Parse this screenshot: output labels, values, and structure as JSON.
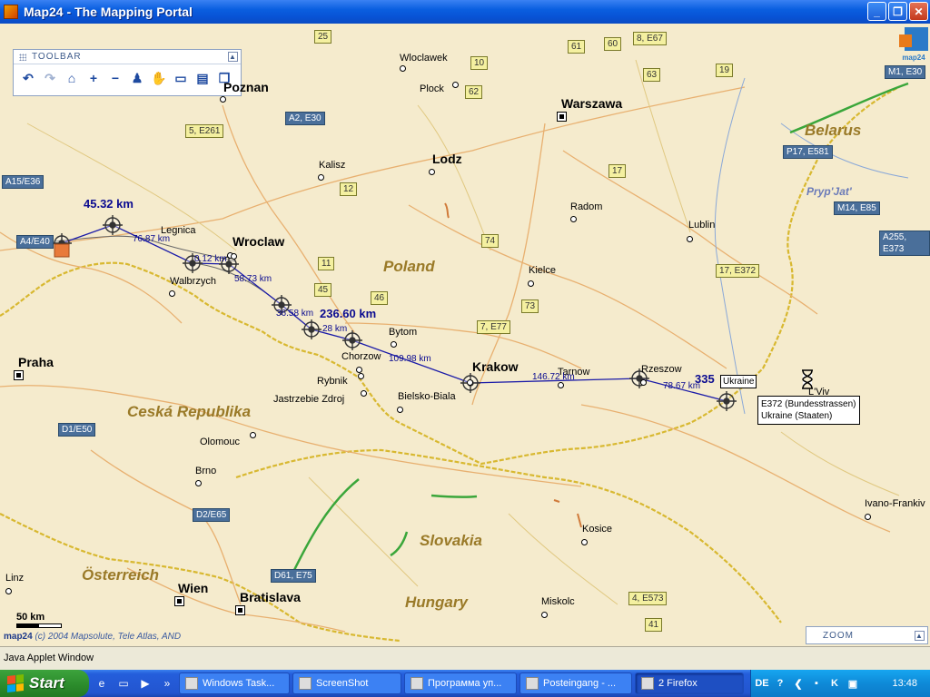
{
  "window": {
    "title": "Map24 - The Mapping Portal",
    "minimize": "_",
    "maximize": "❐",
    "close": "✕"
  },
  "toolbar": {
    "title": "TOOLBAR",
    "collapse": "▲",
    "tools": [
      {
        "icon": "back-arrow-icon",
        "glyph": "↶",
        "enabled": true
      },
      {
        "icon": "forward-arrow-icon",
        "glyph": "↷",
        "enabled": false
      },
      {
        "icon": "home-icon",
        "glyph": "⌂",
        "enabled": true
      },
      {
        "icon": "zoom-in-icon",
        "glyph": "+",
        "enabled": true
      },
      {
        "icon": "zoom-out-icon",
        "glyph": "−",
        "enabled": true
      },
      {
        "icon": "person-icon",
        "glyph": "♟",
        "enabled": true
      },
      {
        "icon": "hand-pan-icon",
        "glyph": "✋",
        "enabled": true
      },
      {
        "icon": "measure-icon",
        "glyph": "▭",
        "enabled": true
      },
      {
        "icon": "print-icon",
        "glyph": "▤",
        "enabled": true
      },
      {
        "icon": "windows-icon",
        "glyph": "❐",
        "enabled": true
      }
    ]
  },
  "map": {
    "countries": [
      "Poland",
      "Ceská Republika",
      "Slovakia",
      "Hungary",
      "Österreich",
      "Belarus"
    ],
    "river": "Pryp'Jat'",
    "cities_big": [
      "Warszawa",
      "Praha",
      "Wien",
      "Krakow",
      "Wroclaw",
      "Poznan",
      "Lodz",
      "Bratislava"
    ],
    "cities": [
      "Wloclawek",
      "Plock",
      "Kalisz",
      "Radom",
      "Lublin",
      "Kielce",
      "Legnica",
      "Walbrzych",
      "Bytom",
      "Chorzow",
      "Rybnik",
      "Jastrzebie Zdroj",
      "Bielsko-Biala",
      "Tarnow",
      "Rzeszow",
      "Olomouc",
      "Brno",
      "Kosice",
      "Miskolc",
      "Linz",
      "L'Viv",
      "Ivano-Frankiv"
    ],
    "shields_yellow": [
      "25",
      "10",
      "62",
      "61",
      "60",
      "8, E67",
      "63",
      "19",
      "5, E261",
      "12",
      "17",
      "74",
      "11",
      "45",
      "46",
      "73",
      "7, E77",
      "17, E372",
      "4, E573",
      "41"
    ],
    "shields_blue": [
      "A2, E30",
      "A15/E36",
      "A4/E40",
      "D1/E50",
      "D2/E65",
      "D61, E75",
      "M1, E30",
      "P17, E581",
      "M14, E85",
      "A255, E373"
    ],
    "route_total": [
      "45.32 km",
      "236.60 km",
      "335"
    ],
    "route_segments": [
      "76.87 km",
      "0.12 km",
      "58.73 km",
      "36.58 km",
      "28 km",
      "109.98 km",
      "146.72 km",
      "78.67 km"
    ],
    "tooltip": {
      "line1": "E372 (Bundesstrassen)",
      "line2": "Ukraine (Staaten)"
    },
    "ukraine_tag": "Ukraine",
    "scale_label": "50 km",
    "copyright_brand": "map24",
    "copyright_text": "(c) 2004 Mapsolute, Tele Atlas, AND",
    "logo_text": "map24"
  },
  "zoom": {
    "title": "ZOOM",
    "collapse": "▲"
  },
  "applet_status": "Java Applet Window",
  "taskbar": {
    "start": "Start",
    "more": "»",
    "tasks": [
      {
        "label": "Windows Task...",
        "active": false
      },
      {
        "label": "ScreenShot",
        "active": false
      },
      {
        "label": "Программа уп...",
        "active": false
      },
      {
        "label": "Posteingang - ...",
        "active": false
      },
      {
        "label": "2 Firefox",
        "active": true
      }
    ],
    "lang": "DE",
    "help": "?",
    "clock": "13:48"
  }
}
